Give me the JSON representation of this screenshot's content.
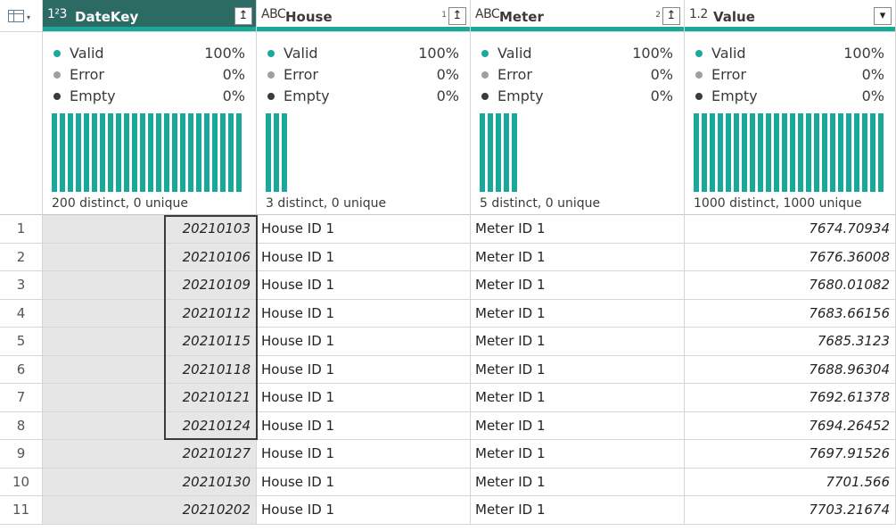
{
  "table_menu_icon": "table-icon",
  "columns": [
    {
      "type_icon_text": "1²3",
      "type_icon": "whole-number-type-icon",
      "name": "DateKey",
      "selected": true,
      "sort_order": "",
      "quality": [
        {
          "label": "Valid",
          "pct": "100%",
          "color": "#1aa89a"
        },
        {
          "label": "Error",
          "pct": "0%",
          "color": "#a0a0a0"
        },
        {
          "label": "Empty",
          "pct": "0%",
          "color": "#3b3a39"
        }
      ],
      "distribution_bar_count": 24,
      "distinct_text": "200 distinct, 0 unique"
    },
    {
      "type_icon_text": "ABC",
      "type_icon": "text-type-icon",
      "name": "House",
      "selected": false,
      "sort_order": "1",
      "quality": [
        {
          "label": "Valid",
          "pct": "100%",
          "color": "#1aa89a"
        },
        {
          "label": "Error",
          "pct": "0%",
          "color": "#a0a0a0"
        },
        {
          "label": "Empty",
          "pct": "0%",
          "color": "#3b3a39"
        }
      ],
      "distribution_bar_count": 3,
      "distinct_text": "3 distinct, 0 unique"
    },
    {
      "type_icon_text": "ABC",
      "type_icon": "text-type-icon",
      "name": "Meter",
      "selected": false,
      "sort_order": "2",
      "quality": [
        {
          "label": "Valid",
          "pct": "100%",
          "color": "#1aa89a"
        },
        {
          "label": "Error",
          "pct": "0%",
          "color": "#a0a0a0"
        },
        {
          "label": "Empty",
          "pct": "0%",
          "color": "#3b3a39"
        }
      ],
      "distribution_bar_count": 5,
      "distinct_text": "5 distinct, 0 unique"
    },
    {
      "type_icon_text": "1.2",
      "type_icon": "decimal-number-type-icon",
      "name": "Value",
      "selected": false,
      "sort_order": "",
      "quality": [
        {
          "label": "Valid",
          "pct": "100%",
          "color": "#1aa89a"
        },
        {
          "label": "Error",
          "pct": "0%",
          "color": "#a0a0a0"
        },
        {
          "label": "Empty",
          "pct": "0%",
          "color": "#3b3a39"
        }
      ],
      "distribution_bar_count": 24,
      "distinct_text": "1000 distinct, 1000 unique"
    }
  ],
  "rows": [
    {
      "n": "1",
      "datekey": "20210103",
      "house": "House ID 1",
      "meter": "Meter ID 1",
      "value": "7674.70934"
    },
    {
      "n": "2",
      "datekey": "20210106",
      "house": "House ID 1",
      "meter": "Meter ID 1",
      "value": "7676.36008"
    },
    {
      "n": "3",
      "datekey": "20210109",
      "house": "House ID 1",
      "meter": "Meter ID 1",
      "value": "7680.01082"
    },
    {
      "n": "4",
      "datekey": "20210112",
      "house": "House ID 1",
      "meter": "Meter ID 1",
      "value": "7683.66156"
    },
    {
      "n": "5",
      "datekey": "20210115",
      "house": "House ID 1",
      "meter": "Meter ID 1",
      "value": "7685.3123"
    },
    {
      "n": "6",
      "datekey": "20210118",
      "house": "House ID 1",
      "meter": "Meter ID 1",
      "value": "7688.96304"
    },
    {
      "n": "7",
      "datekey": "20210121",
      "house": "House ID 1",
      "meter": "Meter ID 1",
      "value": "7692.61378"
    },
    {
      "n": "8",
      "datekey": "20210124",
      "house": "House ID 1",
      "meter": "Meter ID 1",
      "value": "7694.26452"
    },
    {
      "n": "9",
      "datekey": "20210127",
      "house": "House ID 1",
      "meter": "Meter ID 1",
      "value": "7697.91526"
    },
    {
      "n": "10",
      "datekey": "20210130",
      "house": "House ID 1",
      "meter": "Meter ID 1",
      "value": "7701.566"
    },
    {
      "n": "11",
      "datekey": "20210202",
      "house": "House ID 1",
      "meter": "Meter ID 1",
      "value": "7703.21674"
    }
  ]
}
